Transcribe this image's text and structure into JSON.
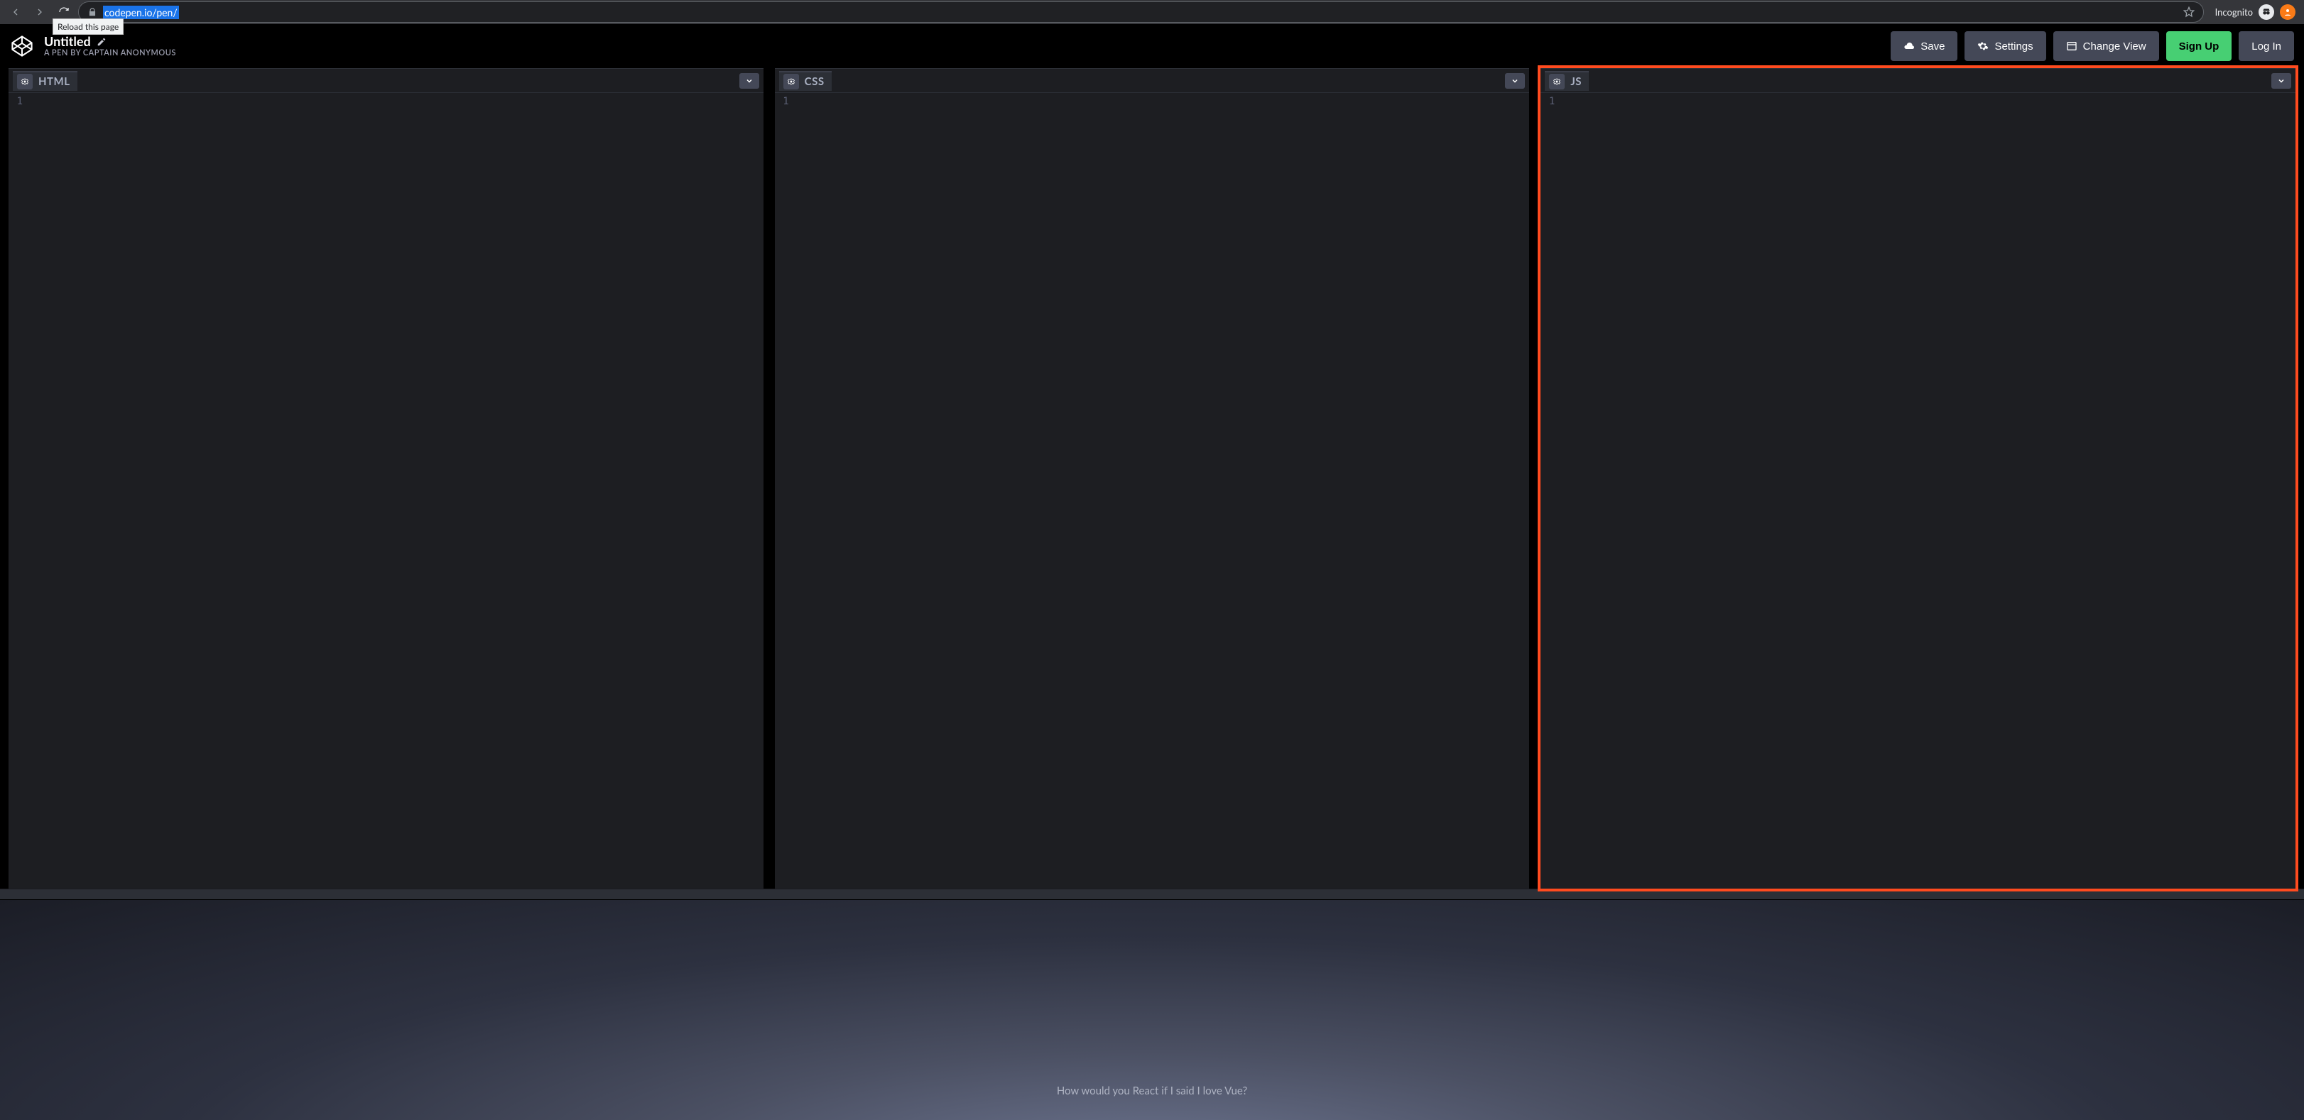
{
  "browser": {
    "url": "codepen.io/pen/",
    "reload_tooltip": "Reload this page",
    "incognito_label": "Incognito"
  },
  "header": {
    "title": "Untitled",
    "subtitle": "A PEN BY CAPTAIN ANONYMOUS",
    "buttons": {
      "save": "Save",
      "settings": "Settings",
      "change_view": "Change View",
      "sign_up": "Sign Up",
      "log_in": "Log In"
    }
  },
  "editors": {
    "html": {
      "title": "HTML",
      "line_no": "1"
    },
    "css": {
      "title": "CSS",
      "line_no": "1"
    },
    "js": {
      "title": "JS",
      "line_no": "1",
      "highlighted": true
    }
  },
  "preview": {
    "text": "How would you React if I said I love Vue?"
  }
}
